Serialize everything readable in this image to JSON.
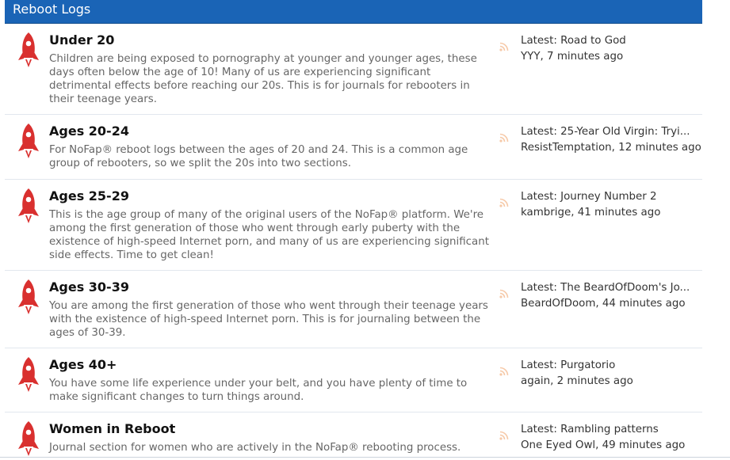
{
  "header": {
    "title": "Reboot Logs"
  },
  "forums": [
    {
      "title": "Under 20",
      "description": "Children are being exposed to pornography at younger and younger ages, these days often below the age of 10! Many of us are experiencing significant detrimental effects before reaching our 20s. This is for journals for rebooters in their teenage years.",
      "latest_title": "Latest: Road to God",
      "latest_meta": "YYY, 7 minutes ago"
    },
    {
      "title": "Ages 20-24",
      "description": "For NoFap® reboot logs between the ages of 20 and 24. This is a common age group of rebooters, so we split the 20s into two sections.",
      "latest_title": "Latest: 25-Year Old Virgin: Tryi...",
      "latest_meta": "ResistTemptation, 12 minutes ago"
    },
    {
      "title": "Ages 25-29",
      "description": "This is the age group of many of the original users of the NoFap® platform. We're among the first generation of those who went through early puberty with the existence of high-speed Internet porn, and many of us are experiencing significant side effects. Time to get clean!",
      "latest_title": "Latest: Journey Number 2",
      "latest_meta": "kambrige, 41 minutes ago"
    },
    {
      "title": "Ages 30-39",
      "description": "You are among the first generation of those who went through their teenage years with the existence of high-speed Internet porn. This is for journaling between the ages of 30-39.",
      "latest_title": "Latest: The BeardOfDoom's Jo...",
      "latest_meta": "BeardOfDoom, 44 minutes ago"
    },
    {
      "title": "Ages 40+",
      "description": "You have some life experience under your belt, and you have plenty of time to make significant changes to turn things around.",
      "latest_title": "Latest: Purgatorio",
      "latest_meta": "again, 2 minutes ago"
    },
    {
      "title": "Women in Reboot",
      "description": "Journal section for women who are actively in the NoFap® rebooting process.",
      "latest_title": "Latest: Rambling patterns",
      "latest_meta": "One Eyed Owl, 49 minutes ago"
    }
  ],
  "icons": {
    "forum": "rocket-icon",
    "feed": "rss-icon"
  },
  "colors": {
    "header_bg": "#1a64b6",
    "rocket": "#d9302f",
    "rss": "#f6c9a8"
  }
}
